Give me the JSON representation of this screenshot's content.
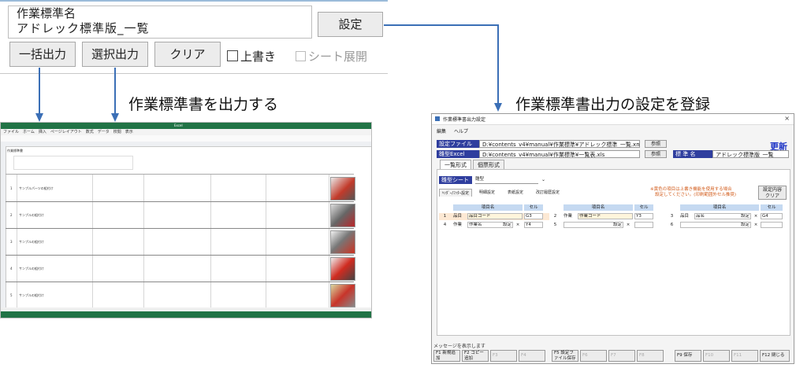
{
  "top_form": {
    "name_label": "作業標準名",
    "name_value": "アドレック標準版_一覧",
    "settei_button": "設定",
    "ikkatsu_button": "一括出力",
    "sentaku_button": "選択出力",
    "clear_button": "クリア",
    "overwrite_label": "上書き",
    "sheet_expand_label": "シート展開"
  },
  "captions": {
    "left": "作業標準書を出力する",
    "right": "作業標準書出力の設定を登録"
  },
  "colors": {
    "arrow": "#3b6fb6",
    "excel_green": "#217346",
    "dialog_label": "#2f3e9e",
    "update_blue": "#1e35c6",
    "note_orange": "#d25b1a"
  },
  "excel_preview": {
    "window_title": "Excel",
    "ribbon_tabs": "ファイル　ホーム　挿入　ページレイアウト　数式　データ　校閲　表示",
    "sheet_title": "作業標準書",
    "rows": [
      {
        "no": "1",
        "name": "サンプルパーツの組付け"
      },
      {
        "no": "2",
        "name": "サンプルの組付け"
      },
      {
        "no": "3",
        "name": "サンプルの組付け"
      },
      {
        "no": "4",
        "name": "サンプルの組付け"
      },
      {
        "no": "5",
        "name": "サンプルの組付け"
      }
    ]
  },
  "dialog": {
    "title": "作業標準書出力設定",
    "close": "×",
    "menu": [
      "編集",
      "ヘルプ"
    ],
    "settings_file_label": "設定ファイル",
    "settings_file_path": "D:¥contents_v4¥manual¥作業標準¥アドレック標準_一覧.xml",
    "ref_button": "参照",
    "template_label": "雛型Excel",
    "template_path": "D:¥contents_v4¥manual¥作業標準¥一覧表.xls",
    "ref_button2": "参照",
    "std_name_label": "標 準 名",
    "std_name_value": "アドレック標準版_一覧",
    "update": "更新",
    "tabs": [
      "一覧形式",
      "個票形式"
    ],
    "template_sheet_label": "雛型シート名",
    "template_sheet_value": "雛型",
    "subtabs": [
      "ﾍｯﾀﾞｰ/ﾌｯﾀｰ設定",
      "明細設定",
      "表紙設定",
      "改訂履歴設定"
    ],
    "note_line1": "※黄色の項目は上書き機能を使用する場合",
    "note_line2": "設定してください。(印刷範囲外セル推奨)",
    "clear_button_line1": "設定内容",
    "clear_button_line2": "クリア",
    "col_header_item": "項目名",
    "col_header_cell": "セル",
    "rows": [
      {
        "no": "1",
        "kind": "品目",
        "item": "品目コード",
        "cell": "G3",
        "settable": false
      },
      {
        "no": "2",
        "kind": "作業",
        "item": "作業コード",
        "cell": "Y3",
        "settable": false
      },
      {
        "no": "3",
        "kind": "品目",
        "item": "品名",
        "cell": "G4",
        "settable": true
      },
      {
        "no": "4",
        "kind": "作業",
        "item": "作業名",
        "cell": "Y4",
        "settable": true
      },
      {
        "no": "5",
        "kind": "",
        "item": "",
        "cell": "",
        "settable": true
      },
      {
        "no": "6",
        "kind": "",
        "item": "",
        "cell": "",
        "settable": true
      }
    ],
    "set_label": "設定",
    "x_label": "×",
    "message": "メッセージを表示します",
    "fkeys": [
      {
        "label": "F1 新規追加",
        "enabled": true
      },
      {
        "label": "F2 コピー追加",
        "enabled": true
      },
      {
        "label": "F3",
        "enabled": false
      },
      {
        "label": "F4",
        "enabled": false
      },
      {
        "label": "F5 設定ファイル保存",
        "enabled": true
      },
      {
        "label": "F6",
        "enabled": false
      },
      {
        "label": "F7",
        "enabled": false
      },
      {
        "label": "F8",
        "enabled": false
      },
      {
        "label": "F9 保存",
        "enabled": true
      },
      {
        "label": "F10",
        "enabled": false
      },
      {
        "label": "F11",
        "enabled": false
      },
      {
        "label": "F12 閉じる",
        "enabled": true
      }
    ]
  }
}
